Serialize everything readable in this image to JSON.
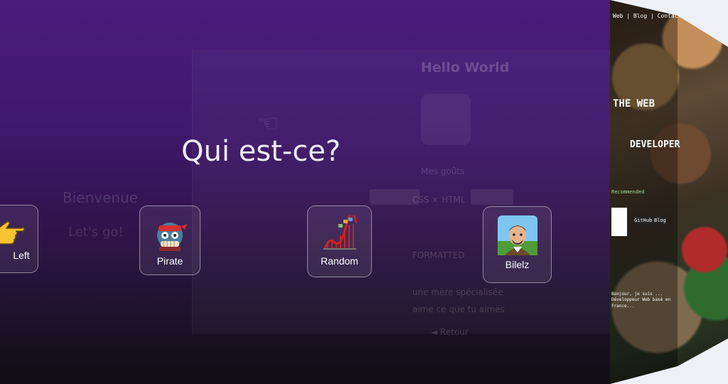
{
  "heading": "Qui est-ce?",
  "choices": [
    {
      "label": "Left",
      "icon": "pointing-hand-icon"
    },
    {
      "label": "Pirate",
      "icon": "pirate-cat-icon"
    },
    {
      "label": "Random",
      "icon": "roller-coaster-icon"
    },
    {
      "label": "Bilelz",
      "icon": "avatar-icon"
    }
  ],
  "background_page": {
    "title": "Hello World",
    "section": "Mes goûts",
    "left_greeting": "Bienvenue",
    "left_sub": "Let's go!",
    "rows": [
      "CSS ×  HTML",
      "FORMATTED",
      "une mère spécialisée",
      "aime ce que tu aimes",
      "◄ Retour"
    ]
  },
  "side_panel": {
    "title_line1": "THE WEB",
    "title_line2": "DEVELOPER",
    "recommend": "Recommended",
    "tags": [
      "GitHub",
      "Blog"
    ],
    "intro": "Bonjour, je suis ... Développeur Web basé en France...",
    "nav": [
      "Web",
      "Blog",
      "Contact"
    ]
  },
  "colors": {
    "accent": "#4a1c7d",
    "card_border": "#ffffff",
    "heading": "#f1ecf7"
  }
}
